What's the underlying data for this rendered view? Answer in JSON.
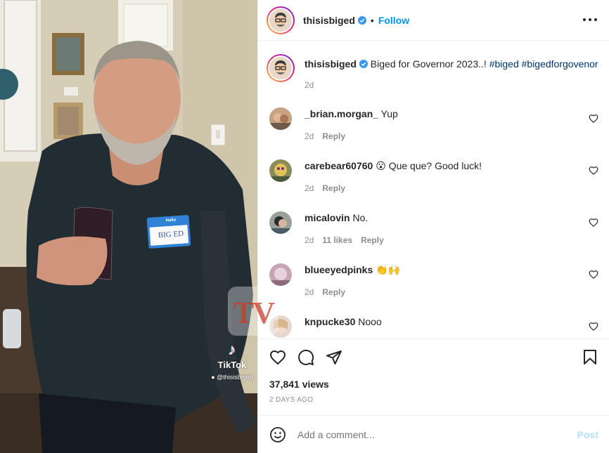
{
  "header": {
    "username": "thisisbiged",
    "separator": "•",
    "follow_label": "Follow",
    "more_icon": "more-horizontal-icon"
  },
  "caption": {
    "username": "thisisbiged",
    "text": "Biged for Governor 2023..!",
    "hashtags": [
      "#biged",
      "#bigedforgovenor"
    ],
    "time": "2d"
  },
  "comments": [
    {
      "username": "_brian.morgan_",
      "text": "Yup",
      "time": "2d",
      "likes": "",
      "reply_label": "Reply"
    },
    {
      "username": "carebear60760",
      "emoji": "😮",
      "text": "Que que? Good luck!",
      "time": "2d",
      "likes": "",
      "reply_label": "Reply"
    },
    {
      "username": "micalovin",
      "text": "No.",
      "time": "2d",
      "likes": "11 likes",
      "reply_label": "Reply"
    },
    {
      "username": "blueeyedpinks",
      "emoji": "👏🙌",
      "text": "",
      "time": "2d",
      "likes": "",
      "reply_label": "Reply"
    },
    {
      "username": "knpucke30",
      "text": "Nooo",
      "time": "",
      "likes": "",
      "reply_label": ""
    }
  ],
  "video": {
    "overlay_brand": "TikTok",
    "overlay_handle": "@thisisbiged",
    "watermark": "TV",
    "name_tag_header": "Hello",
    "name_tag_text": "BIG ED"
  },
  "actions": {
    "views": "37,841 views",
    "posted": "2 DAYS AGO"
  },
  "add_comment": {
    "placeholder": "Add a comment...",
    "post_label": "Post"
  },
  "colors": {
    "link_blue": "#0095f6",
    "hashtag": "#00376b",
    "muted": "#8e8e8e",
    "post_disabled": "#b2dffc"
  }
}
